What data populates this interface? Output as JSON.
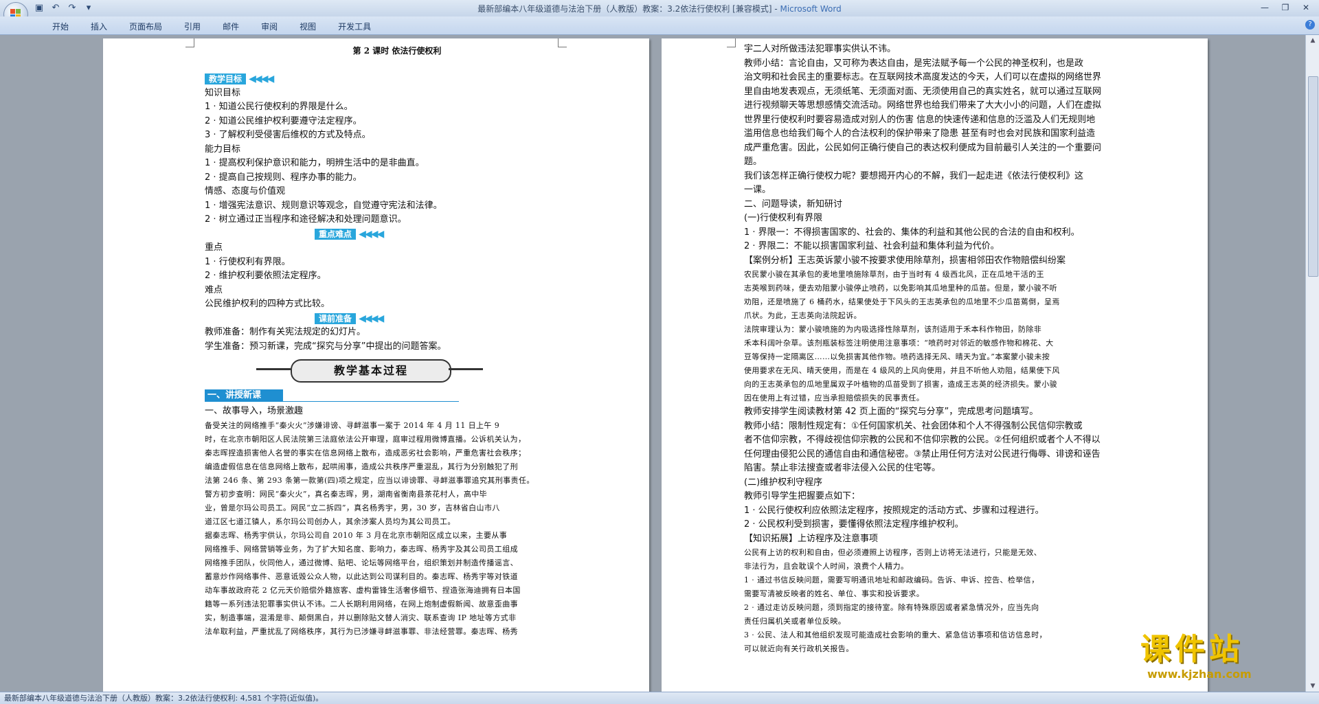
{
  "window": {
    "title": "最新部编本八年级道德与法治下册（人教版）教案：3.2依法行使权利 [兼容模式] - ",
    "app_name": "Microsoft Word"
  },
  "ribbon": {
    "tabs": [
      "开始",
      "插入",
      "页面布局",
      "引用",
      "邮件",
      "审阅",
      "视图",
      "开发工具"
    ]
  },
  "page1": {
    "header": "第 2 课时  依法行使权利",
    "goal_badge": "教学目标",
    "lines_a": [
      "知识目标",
      "1 · 知道公民行使权利的界限是什么。",
      "2 · 知道公民维护权利要遵守法定程序。",
      "3 · 了解权利受侵害后维权的方式及特点。",
      "能力目标",
      "1 · 提高权利保护意识和能力，明辨生活中的是非曲直。",
      "2 · 提高自己按规则、程序办事的能力。",
      "情感、态度与价值观",
      "1 · 增强宪法意识、规则意识等观念，自觉遵守宪法和法律。",
      "2 · 树立通过正当程序和途径解决和处理问题意识。"
    ],
    "key_badge": "重点难点",
    "lines_b": [
      "重点",
      "1 · 行使权利有界限。",
      "2 · 维护权利要依照法定程序。",
      "难点",
      "公民维护权利的四种方式比较。"
    ],
    "prep_badge": "课前准备",
    "lines_c": [
      "教师准备：制作有关宪法规定的幻灯片。",
      "学生准备：预习新课，完成“探究与分享”中提出的问题答案。"
    ],
    "banner": "教学基本过程",
    "section": "一、讲授新课",
    "lines_d": [
      "一、故事导入，场景激趣"
    ],
    "small_lines": [
      "备受关注的网络推手“秦火火”涉嫌诽谤、寻衅滋事一案于 2014 年 4 月 11 日上午 9",
      "时，在北京市朝阳区人民法院第三法庭依法公开审理，庭审过程用微博直播。公诉机关认为，",
      "秦志晖捏造损害他人名誉的事实在信息网络上散布，造成恶劣社会影响，严重危害社会秩序；",
      "编造虚假信息在信息网络上散布，起哄闹事，造成公共秩序严重混乱，其行为分别触犯了刑",
      "法第 246 条、第 293 条第一款第(四)项之规定，应当以诽谤罪、寻衅滋事罪追究其刑事责任。",
      "警方初步查明：网民“秦火火”，真名秦志晖，男，湖南省衡南县茶花村人，高中毕",
      "业，曾是尔玛公司员工。网民“立二拆四”，真名杨秀宇，男，30 岁，吉林省白山市八",
      "道江区七道江镇人，系尔玛公司创办人，其余涉案人员均为其公司员工。",
      "据秦志晖、杨秀宇供认，尔玛公司自 2010 年 3 月在北京市朝阳区成立以来，主要从事",
      "网络推手、网络营销等业务，为了扩大知名度、影响力，秦志晖、杨秀宇及其公司员工组成",
      "网络推手团队，伙同他人，通过微博、贴吧、论坛等网络平台，组织策划并制造传播谣言、",
      "蓄意炒作网络事件、恶意诋毁公众人物，以此达到公司谋利目的。秦志晖、杨秀宇等对铁道",
      "动车事故政府花 2 亿元天价赔偿外籍旅客、虚构雷锋生活奢侈细节、捏造张海迪拥有日本国",
      "籍等一系列违法犯罪事实供认不讳。二人长期利用网络，在网上炮制虚假新闻、故意歪曲事",
      "实，制造事端，混淆是非、颠倒黑白，并以删除贴文替人消灾、联系查询 IP 地址等方式非",
      "法牟取利益，严重扰乱了网络秩序，其行为已涉嫌寻衅滋事罪、非法经营罪。秦志晖、杨秀"
    ]
  },
  "page2": {
    "lines_a": [
      "宇二人对所做违法犯罪事实供认不讳。",
      "教师小结：言论自由，又可称为表达自由，是宪法赋予每一个公民的神圣权利，也是政",
      "治文明和社会民主的重要标志。在互联网技术高度发达的今天，人们可以在虚拟的网络世界",
      "里自由地发表观点，无须纸笔、无须面对面、无须使用自己的真实姓名，就可以通过互联网",
      "进行视频聊天等思想感情交流活动。网络世界也给我们带来了大大小小的问题，人们在虚拟",
      "世界里行使权利时要容易造成对别人的伤害 信息的快速传递和信息的泛滥及人们无规则地",
      "滥用信息也给我们每个人的合法权利的保护带来了隐患 甚至有时也会对民族和国家利益造",
      "成严重危害。因此，公民如何正确行使自己的表达权利便成为目前最引人关注的一个重要问",
      "题。",
      "我们该怎样正确行使权力呢？要想揭开内心的不解，我们一起走进《依法行使权利》这",
      "一课。",
      "二、问题导读，新知研讨",
      "(一)行使权利有界限",
      "1 · 界限一：不得损害国家的、社会的、集体的利益和其他公民的合法的自由和权利。",
      "2 · 界限二：不能以损害国家利益、社会利益和集体利益为代价。",
      "【案例分析】王志英诉蒙小骏不按要求使用除草剂，损害相邻田农作物赔偿纠纷案"
    ],
    "small_a": [
      "农民蒙小骏在其承包的麦地里喷施除草剂，由于当时有 4 级西北风，正在瓜地干活的王",
      "志英喉到药味，便去劝阻蒙小骏停止喷药，以免影响其瓜地里种的瓜苗。但是，蒙小骏不听",
      "劝阻，还是喷施了 6 桶药水，结果使处于下风头的王志英承包的瓜地里不少瓜苗蔫倒，呈焉",
      "爪状。为此，王志英向法院起诉。",
      "法院审理认为：蒙小骏喷施的为内吸选择性除草剂，该剂适用于禾本科作物田，防除非",
      "禾本科阔叶杂草。该剂瓶装标签注明使用注意事项：“喷药时对邻近的敏感作物和棉花、大",
      "豆等保持一定隔离区……以免损害其他作物。喷药选择无风、晴天为宜。”本案蒙小骏未按",
      "使用要求在无风、晴天使用，而是在 4 级风的上风向使用，并且不听他人劝阻，结果使下风",
      "向的王志英承包的瓜地里属双子叶植物的瓜苗受到了损害，造成王志英的经济损失。蒙小骏",
      "因在使用上有过错，应当承担赔偿损失的民事责任。"
    ],
    "lines_b": [
      "教师安排学生阅读教材第 42 页上面的“探究与分享”，完成思考问题填写。",
      "教师小结：限制性规定有：①任何国家机关、社会团体和个人不得强制公民信仰宗教或",
      "者不信仰宗教，不得歧视信仰宗教的公民和不信仰宗教的公民。②任何组织或者个人不得以",
      "任何理由侵犯公民的通信自由和通信秘密。③禁止用任何方法对公民进行侮辱、诽谤和诬告",
      "陷害。禁止非法搜查或者非法侵入公民的住宅等。",
      "(二)维护权利守程序",
      "教师引导学生把握要点如下：",
      "1 · 公民行使权利应依照法定程序，按照规定的活动方式、步骤和过程进行。",
      "2 · 公民权利受到损害，要懂得依照法定程序维护权利。",
      "【知识拓展】上访程序及注意事项"
    ],
    "small_b": [
      "公民有上访的权利和自由，但必须遵照上访程序，否则上访将无法进行，只能是无效、",
      "非法行为，且会耽误个人时间，浪费个人精力。",
      "1 · 通过书信反映问题，需要写明通讯地址和邮政编码。告诉、申诉、控告、检举信，",
      "需要写清被反映者的姓名、单位、事实和投诉要求。",
      "2 · 通过走访反映问题，须到指定的接待室。除有特殊原因或者紧急情况外，应当先向",
      "责任归属机关或者单位反映。",
      "3 · 公民、法人和其他组织发现可能造成社会影响的重大、紧急信访事项和信访信息时，",
      "可以就近向有关行政机关报告。"
    ]
  },
  "status": {
    "text": "最新部编本八年级道德与法治下册（人教版）教案：3.2依法行使权利: 4,581 个字符(近似值)。"
  },
  "watermark": {
    "big": "课件站",
    "url": "www.kjzhan.com"
  },
  "colors": {
    "badge": "#29a6dc",
    "section_bar": "#1f8fd1",
    "watermark": "#f0c400",
    "app_title_accent": "#3b6db3"
  }
}
